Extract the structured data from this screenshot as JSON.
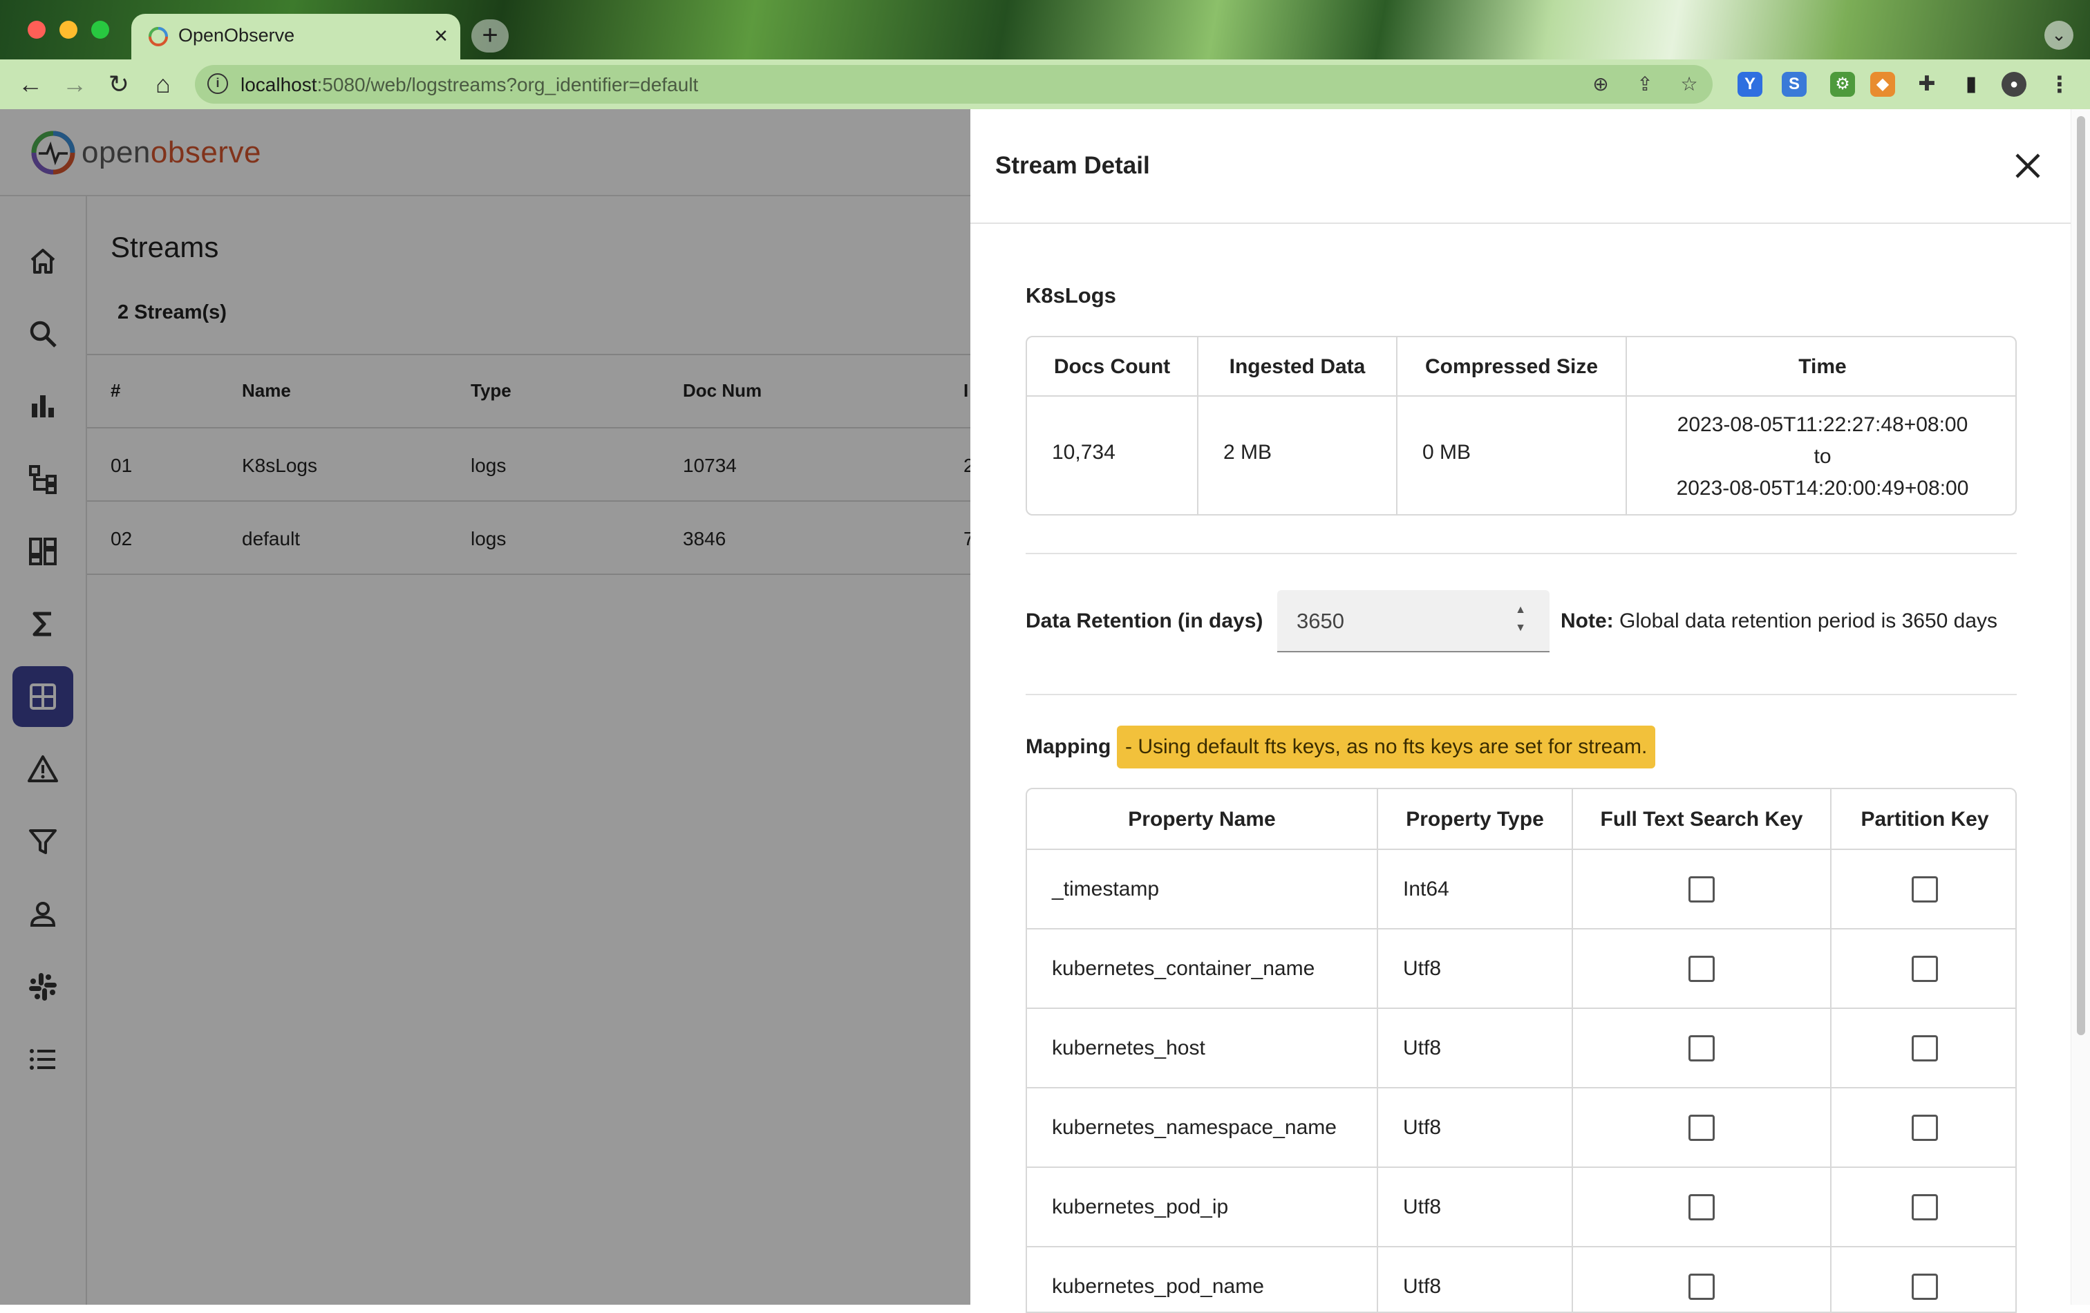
{
  "browser": {
    "tab_title": "OpenObserve",
    "url_host": "localhost",
    "url_rest": ":5080/web/logstreams?org_identifier=default"
  },
  "app": {
    "logo_part1": "open",
    "logo_part2": "observe",
    "page_title": "Streams",
    "stream_count": "2 Stream(s)",
    "list_headers": [
      "#",
      "Name",
      "Type",
      "Doc Num",
      "I"
    ],
    "list_rows": [
      {
        "idx": "01",
        "name": "K8sLogs",
        "type": "logs",
        "docs": "10734",
        "trunc": "2"
      },
      {
        "idx": "02",
        "name": "default",
        "type": "logs",
        "docs": "3846",
        "trunc": "7"
      }
    ],
    "sidebar": [
      {
        "icon": "home-icon"
      },
      {
        "icon": "search-icon"
      },
      {
        "icon": "bar-chart-icon"
      },
      {
        "icon": "hierarchy-icon"
      },
      {
        "icon": "dashboard-icon"
      },
      {
        "icon": "sigma-icon"
      },
      {
        "icon": "grid-icon",
        "active": true
      },
      {
        "icon": "alert-triangle-icon"
      },
      {
        "icon": "filter-icon"
      },
      {
        "icon": "user-icon"
      },
      {
        "icon": "slack-icon"
      },
      {
        "icon": "list-icon"
      }
    ]
  },
  "drawer": {
    "title": "Stream Detail",
    "stream_name": "K8sLogs",
    "stats_headers": [
      "Docs Count",
      "Ingested Data",
      "Compressed Size",
      "Time"
    ],
    "stats": {
      "docs_count": "10,734",
      "ingested": "2 MB",
      "compressed": "0 MB",
      "time_from": "2023-08-05T11:22:27:48+08:00",
      "time_to_word": "to",
      "time_to": "2023-08-05T14:20:00:49+08:00"
    },
    "retention_label": "Data Retention (in days)",
    "retention_value": "3650",
    "note_label": "Note:",
    "note_text": "Global data retention period is 3650 days",
    "mapping_label": "Mapping",
    "mapping_badge": "- Using default fts keys, as no fts keys are set for stream.",
    "mapping_headers": [
      "Property Name",
      "Property Type",
      "Full Text Search Key",
      "Partition Key"
    ],
    "properties": [
      {
        "name": "_timestamp",
        "type": "Int64"
      },
      {
        "name": "kubernetes_container_name",
        "type": "Utf8"
      },
      {
        "name": "kubernetes_host",
        "type": "Utf8"
      },
      {
        "name": "kubernetes_namespace_name",
        "type": "Utf8"
      },
      {
        "name": "kubernetes_pod_ip",
        "type": "Utf8"
      },
      {
        "name": "kubernetes_pod_name",
        "type": "Utf8"
      }
    ]
  },
  "colors": {
    "accent": "#3e4396",
    "badge": "#f2c13b",
    "logo_orange": "#d7562d"
  }
}
